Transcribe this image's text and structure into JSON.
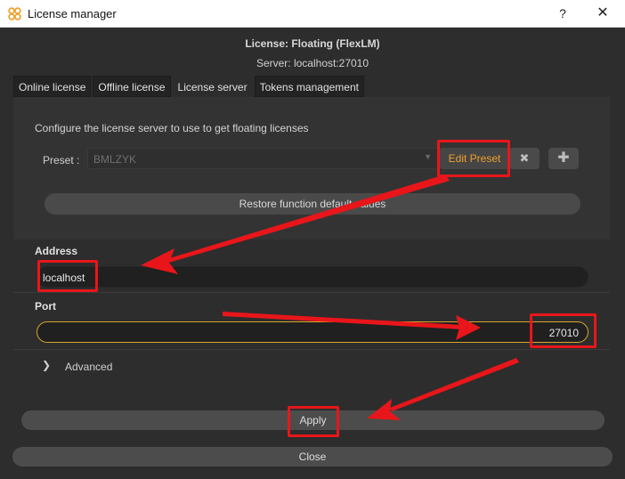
{
  "window": {
    "title": "License manager",
    "help_label": "?",
    "close_label": "✕"
  },
  "header": {
    "title": "License: Floating (FlexLM)",
    "server": "Server: localhost:27010"
  },
  "tabs": [
    {
      "label": "Online license"
    },
    {
      "label": "Offline license"
    },
    {
      "label": "License server"
    },
    {
      "label": "Tokens management"
    }
  ],
  "panel": {
    "description": "Configure the license server to use to get floating licenses",
    "preset_label": "Preset :",
    "preset_value": "BMLZYK",
    "edit_preset_label": "Edit Preset",
    "delete_icon": "✖",
    "add_icon": "✚",
    "restore_label": "Restore function default values"
  },
  "address": {
    "label": "Address",
    "value": "localhost"
  },
  "port": {
    "label": "Port",
    "value": "27010"
  },
  "advanced": {
    "label": "Advanced"
  },
  "buttons": {
    "apply_label": "Apply",
    "close_label": "Close"
  },
  "colors": {
    "accent": "#f0a02a",
    "annotation": "#e8161a",
    "background": "#2d2d2d"
  }
}
